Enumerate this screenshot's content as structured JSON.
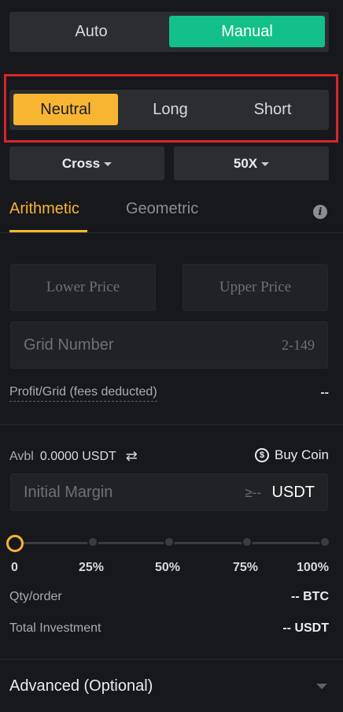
{
  "mode": {
    "auto": "Auto",
    "manual": "Manual",
    "selected": "Manual"
  },
  "direction": {
    "neutral": "Neutral",
    "long": "Long",
    "short": "Short",
    "selected": "Neutral"
  },
  "margin_mode": "Cross",
  "leverage": "50X",
  "grid_type": {
    "arithmetic": "Arithmetic",
    "geometric": "Geometric",
    "selected": "Arithmetic"
  },
  "inputs": {
    "lower_price": "Lower Price",
    "upper_price": "Upper Price",
    "grid_number": "Grid Number",
    "grid_range": "2-149"
  },
  "profit": {
    "label": "Profit/Grid (fees deducted)",
    "value": "--"
  },
  "available": {
    "label": "Avbl",
    "value": "0.0000 USDT"
  },
  "buy_coin": "Buy Coin",
  "initial_margin": {
    "placeholder": "Initial Margin",
    "min": "≥--",
    "unit": "USDT"
  },
  "slider": {
    "value_percent": 0,
    "ticks": [
      "0",
      "25%",
      "50%",
      "75%",
      "100%"
    ]
  },
  "qty": {
    "label": "Qty/order",
    "value": "-- BTC"
  },
  "total": {
    "label": "Total Investment",
    "value": "-- USDT"
  },
  "advanced": "Advanced (Optional)",
  "colors": {
    "accent_yellow": "#f7b532",
    "accent_green": "#13c08a",
    "highlight_red": "#d9252c"
  }
}
